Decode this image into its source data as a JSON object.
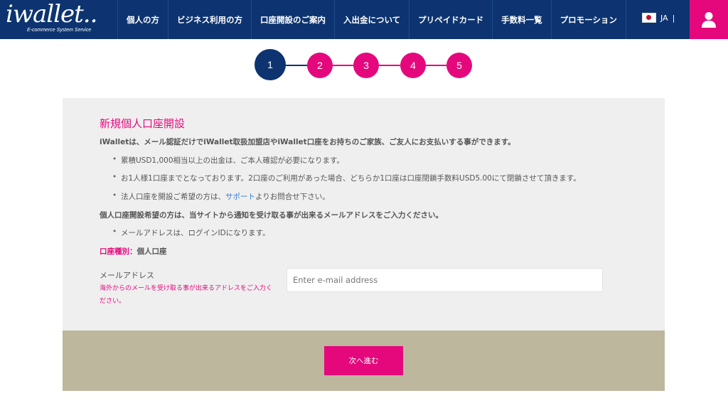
{
  "header": {
    "logo_text": "iwallet..",
    "logo_subtitle": "E-commerce System Service",
    "nav": [
      "個人の方",
      "ビジネス利用の方",
      "口座開設のご案内",
      "入出金について",
      "プリペイドカード",
      "手数料一覧",
      "プロモーション"
    ],
    "language": "JA",
    "language_separator": "|"
  },
  "steps": {
    "items": [
      "1",
      "2",
      "3",
      "4",
      "5"
    ],
    "current": 1,
    "active_color": "#0d3470",
    "pending_color": "#e5087c"
  },
  "form": {
    "title": "新規個人口座開設",
    "intro": "iWalletは、メール認証だけでiWallet取扱加盟店やiWallet口座をお持ちのご家族、ご友人にお支払いする事ができます。",
    "bullet1": "累積USD1,000相当以上の出金は、ご本人確認が必要になります。",
    "bullet2": "お1人様1口座までとなっております。2口座のご利用があった場合、どちらか1口座は口座閉鎖手数料USD5.00にて閉鎖させて頂きます。",
    "bullet3_prefix": "法人口座を開設ご希望の方は、",
    "bullet3_link": "サポート",
    "bullet3_suffix": "よりお問合せ下さい。",
    "email_instruction": "個人口座開設希望の方は、当サイトから通知を受け取る事が出来るメールアドレスをご入力ください。",
    "bullet4": "メールアドレスは、ログインIDになります。",
    "account_type_label": "口座種別：",
    "account_type_value": "個人口座",
    "email_label": "メールアドレス",
    "email_note_line1": "海外からのメールを受け取る事が出来るアドレスをご入力く",
    "email_note_line2": "ださい。",
    "email_placeholder": "Enter e-mail address",
    "email_value": "",
    "next_button": "次へ進む"
  },
  "colors": {
    "header_bg": "#0d3470",
    "accent": "#e5087c",
    "panel_bg": "#efefef",
    "footer_bg": "#bdb79e",
    "link": "#2a7bd6"
  }
}
